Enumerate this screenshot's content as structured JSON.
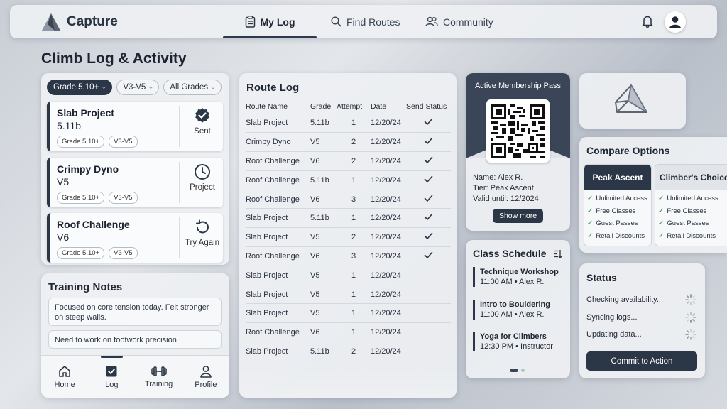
{
  "app": {
    "name": "Capture"
  },
  "nav": {
    "tabs": [
      {
        "label": "My Log",
        "active": true
      },
      {
        "label": "Find Routes"
      },
      {
        "label": "Community"
      }
    ]
  },
  "page": {
    "title": "Climb Log & Activity"
  },
  "filters": [
    {
      "label": "Grade 5.10+",
      "selected": true
    },
    {
      "label": "V3-V5"
    },
    {
      "label": "All Grades"
    }
  ],
  "climbs": [
    {
      "name": "Slab Project",
      "grade": "5.11b",
      "tags": [
        "Grade 5.10+",
        "V3-V5"
      ],
      "status": "Sent",
      "icon": "check-badge-icon"
    },
    {
      "name": "Crimpy Dyno",
      "grade": "V5",
      "tags": [
        "Grade 5.10+",
        "V3-V5"
      ],
      "status": "Project",
      "icon": "clock-icon"
    },
    {
      "name": "Roof Challenge",
      "grade": "V6",
      "tags": [
        "Grade 5.10+",
        "V3-V5"
      ],
      "status": "Try Again",
      "icon": "retry-icon"
    }
  ],
  "training_notes": {
    "title": "Training Notes",
    "notes": [
      "Focused on core tension today. Felt stronger on steep walls.",
      "Need to work on footwork precision"
    ]
  },
  "bottom_nav": [
    {
      "label": "Home",
      "icon": "home-icon"
    },
    {
      "label": "Log",
      "icon": "log-check-icon",
      "active": true
    },
    {
      "label": "Training",
      "icon": "dumbbell-icon"
    },
    {
      "label": "Profile",
      "icon": "profile-icon"
    }
  ],
  "route_log": {
    "title": "Route Log",
    "columns": [
      "Route Name",
      "Grade",
      "Attempt",
      "Date",
      "Send Status"
    ],
    "rows": [
      {
        "name": "Slab Project",
        "grade": "5.11b",
        "attempt": "1",
        "date": "12/20/24",
        "sent": true
      },
      {
        "name": "Crimpy Dyno",
        "grade": "V5",
        "attempt": "2",
        "date": "12/20/24",
        "sent": true
      },
      {
        "name": "Roof Challenge",
        "grade": "V6",
        "attempt": "2",
        "date": "12/20/24",
        "sent": true
      },
      {
        "name": "Roof Challenge",
        "grade": "5.11b",
        "attempt": "1",
        "date": "12/20/24",
        "sent": true
      },
      {
        "name": "Roof Challenge",
        "grade": "V6",
        "attempt": "3",
        "date": "12/20/24",
        "sent": true
      },
      {
        "name": "Slab Project",
        "grade": "5.11b",
        "attempt": "1",
        "date": "12/20/24",
        "sent": true
      },
      {
        "name": "Slab Project",
        "grade": "V5",
        "attempt": "2",
        "date": "12/20/24",
        "sent": true
      },
      {
        "name": "Roof Challenge",
        "grade": "V6",
        "attempt": "3",
        "date": "12/20/24",
        "sent": true
      },
      {
        "name": "Slab Project",
        "grade": "V5",
        "attempt": "1",
        "date": "12/20/24",
        "sent": false
      },
      {
        "name": "Slab Project",
        "grade": "V5",
        "attempt": "1",
        "date": "12/20/24",
        "sent": false
      },
      {
        "name": "Slab Project",
        "grade": "V5",
        "attempt": "1",
        "date": "12/20/24",
        "sent": false
      },
      {
        "name": "Roof Challenge",
        "grade": "V6",
        "attempt": "1",
        "date": "12/20/24",
        "sent": false
      },
      {
        "name": "Slab Project",
        "grade": "5.11b",
        "attempt": "2",
        "date": "12/20/24",
        "sent": false
      }
    ]
  },
  "membership": {
    "title": "Active Membership Pass",
    "name": "Name: Alex R.",
    "tier": "Tier: Peak Ascent",
    "valid": "Valid until: 12/2024",
    "button": "Show more"
  },
  "schedule": {
    "title": "Class Schedule",
    "events": [
      {
        "name": "Technique Workshop",
        "detail": "11:00 AM • Alex R."
      },
      {
        "name": "Intro to Bouldering",
        "detail": "11:00 AM • Alex R."
      },
      {
        "name": "Yoga for Climbers",
        "detail": "12:30 PM • Instructor"
      }
    ]
  },
  "compare": {
    "title": "Compare Options",
    "plans": [
      {
        "name": "Peak Ascent",
        "features": [
          "Unlimited Access",
          "Free Classes",
          "Guest Passes",
          "Retail Discounts"
        ]
      },
      {
        "name": "Climber's Choice",
        "features": [
          "Unlimited Access",
          "Free Classes",
          "Guest Passes",
          "Retail Discounts"
        ]
      }
    ]
  },
  "status": {
    "title": "Status",
    "items": [
      "Checking availability...",
      "Syncing logs...",
      "Updating data..."
    ],
    "button": "Commit to Action"
  },
  "colors": {
    "accent": "#2b3647",
    "success": "#2f8a4a"
  }
}
